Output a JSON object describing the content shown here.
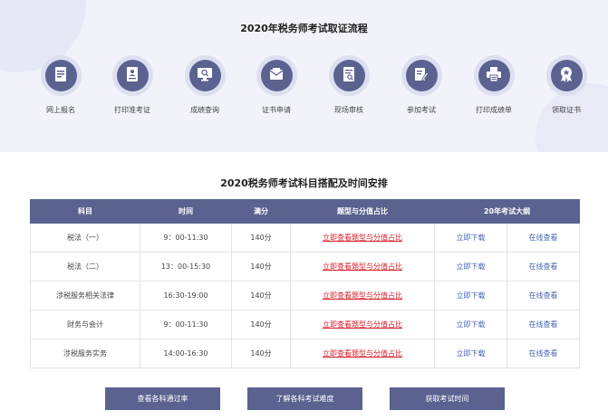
{
  "process": {
    "title": "2020年税务师考试取证流程",
    "steps": [
      {
        "label": "网上报名",
        "icon": "document-icon"
      },
      {
        "label": "打印准考证",
        "icon": "admission-ticket-icon"
      },
      {
        "label": "成绩查询",
        "icon": "search-monitor-icon"
      },
      {
        "label": "证书申请",
        "icon": "envelope-icon"
      },
      {
        "label": "现场审核",
        "icon": "review-icon"
      },
      {
        "label": "参加考试",
        "icon": "edit-document-icon"
      },
      {
        "label": "打印成绩单",
        "icon": "printer-icon"
      },
      {
        "label": "领取证书",
        "icon": "award-icon"
      }
    ]
  },
  "schedule": {
    "title": "2020税务师考试科目搭配及时间安排",
    "headers": [
      "科目",
      "时间",
      "满分",
      "题型与分值占比",
      "20年考试大纲"
    ],
    "rows": [
      {
        "subject": "税法（一）",
        "time": "9：00-11:30",
        "score": "140分",
        "link": "立即查看题型与分值占比",
        "download": "立即下载",
        "online": "在线查看"
      },
      {
        "subject": "税法（二）",
        "time": "13：00-15:30",
        "score": "140分",
        "link": "立即查看题型与分值占比",
        "download": "立即下载",
        "online": "在线查看"
      },
      {
        "subject": "涉税服务相关法律",
        "time": "16:30-19:00",
        "score": "140分",
        "link": "立即查看题型与分值占比",
        "download": "立即下载",
        "online": "在线查看"
      },
      {
        "subject": "财务与会计",
        "time": "9：00-11:30",
        "score": "140分",
        "link": "立即查看题型与分值占比",
        "download": "立即下载",
        "online": "在线查看"
      },
      {
        "subject": "涉税服务实务",
        "time": "14:00-16:30",
        "score": "140分",
        "link": "立即查看题型与分值占比",
        "download": "立即下载",
        "online": "在线查看"
      }
    ]
  },
  "buttons": {
    "pass_rate": "查看各科通过率",
    "difficulty": "了解各科考试难度",
    "exam_time": "获取考试时间"
  },
  "colors": {
    "primary": "#5b628f",
    "link_red": "#d81e2a",
    "link_blue": "#4a64b0",
    "panel_bg": "#f2f3fa"
  }
}
